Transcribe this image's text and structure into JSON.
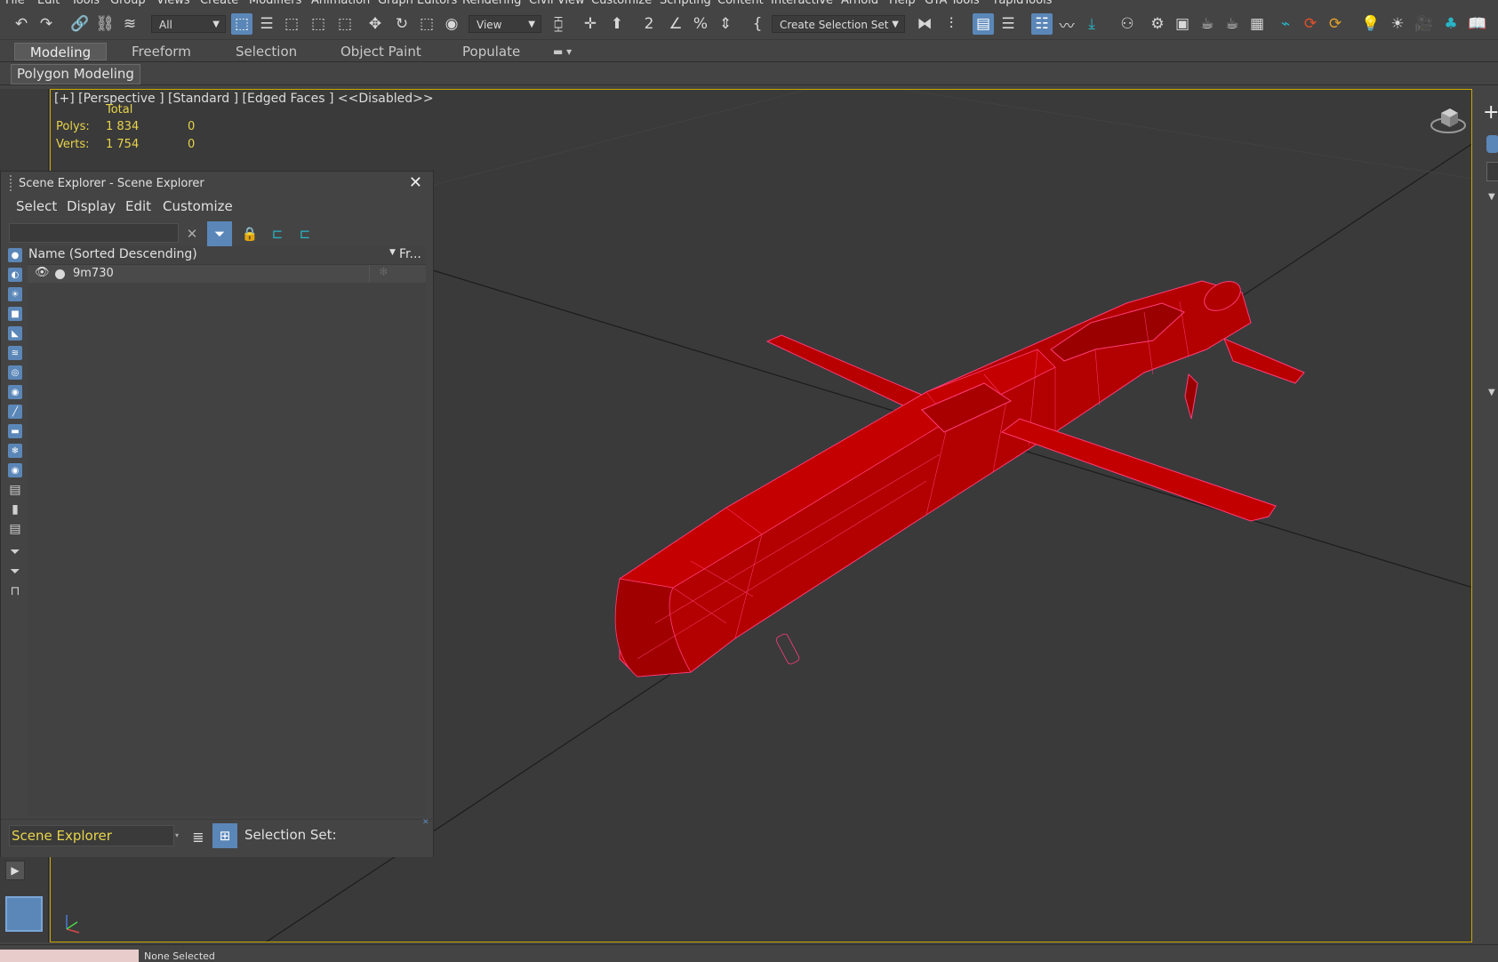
{
  "menu": [
    "File",
    "Edit",
    "Tools",
    "Group",
    "Views",
    "Create",
    "Modifiers",
    "Animation",
    "Graph Editors",
    "Rendering",
    "Civil View",
    "Customize",
    "Scripting",
    "Content",
    "Interactive",
    "Arnold",
    "Help",
    "GTA Tools",
    "rapidTools"
  ],
  "toolbar": {
    "filter_value": "All",
    "refcoord_value": "View",
    "selection_set_value": "Create Selection Set"
  },
  "ribbon": {
    "tabs": [
      "Modeling",
      "Freeform",
      "Selection",
      "Object Paint",
      "Populate"
    ],
    "sub_label": "Polygon Modeling"
  },
  "viewport": {
    "label": "[+] [Perspective ]  [Standard ] [Edged Faces ]  <<Disabled>>",
    "stats": {
      "total_label": "Total",
      "polys_label": "Polys:",
      "polys_total": "1 834",
      "polys_sel": "0",
      "verts_label": "Verts:",
      "verts_total": "1 754",
      "verts_sel": "0"
    },
    "model_color": "#b80000",
    "wire_color": "#ff3d7a"
  },
  "scene_explorer": {
    "title": "Scene Explorer - Scene Explorer",
    "menu": [
      "Select",
      "Display",
      "Edit",
      "Customize"
    ],
    "column_name": "Name (Sorted Descending)",
    "column_frozen": "Fr...",
    "rows": [
      {
        "name": "9m730"
      }
    ],
    "bottom_field": "Scene Explorer",
    "selection_set_label": "Selection Set:"
  },
  "status": {
    "none_selected": "None Selected"
  },
  "colors": {
    "accent": "#5b87b8",
    "stat_yellow": "#e8d44a",
    "viewport_border": "#c8a800"
  }
}
